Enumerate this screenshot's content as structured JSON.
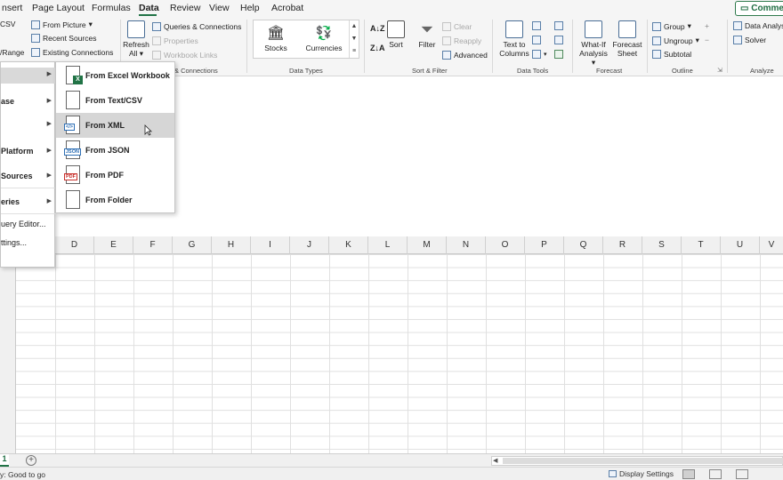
{
  "tabs": [
    "nsert",
    "Page Layout",
    "Formulas",
    "Data",
    "Review",
    "View",
    "Help",
    "Acrobat"
  ],
  "active_tab": "Data",
  "comments_label": "Commen",
  "ribbon": {
    "get_data": {
      "csv": "CSV",
      "range": "/Range"
    },
    "from_picture": "From Picture",
    "recent_sources": "Recent Sources",
    "existing_connections": "Existing Connections",
    "refresh_all": {
      "line1": "Refresh",
      "line2": "All"
    },
    "queries_connections": "Queries & Connections",
    "properties": "Properties",
    "workbook_links": "Workbook Links",
    "queries_group": "& Connections",
    "stocks": "Stocks",
    "currencies": "Currencies",
    "data_types_group": "Data Types",
    "sort": "Sort",
    "filter": "Filter",
    "clear": "Clear",
    "reapply": "Reapply",
    "advanced": "Advanced",
    "sort_filter_group": "Sort & Filter",
    "text_to_columns": {
      "line1": "Text to",
      "line2": "Columns"
    },
    "data_tools_group": "Data Tools",
    "what_if": {
      "line1": "What-If",
      "line2": "Analysis"
    },
    "forecast_sheet": {
      "line1": "Forecast",
      "line2": "Sheet"
    },
    "forecast_group": "Forecast",
    "group": "Group",
    "ungroup": "Ungroup",
    "subtotal": "Subtotal",
    "outline_group": "Outline",
    "data_analysis": "Data Analys",
    "solver": "Solver",
    "analyze_group": "Analyze"
  },
  "menu1": [
    {
      "label": "",
      "arrow": true
    },
    {
      "label": "ase",
      "arrow": true
    },
    {
      "label": "",
      "arrow": true
    },
    {
      "label": "Platform",
      "arrow": true
    },
    {
      "label": "Sources",
      "arrow": true
    },
    {
      "label": "eries",
      "arrow": true
    },
    {
      "label": "uery Editor...",
      "arrow": false
    },
    {
      "label": "ttings...",
      "arrow": false
    }
  ],
  "menu2": [
    {
      "label": "From Excel Workbook",
      "icon": "excel-workbook-icon"
    },
    {
      "label": "From Text/CSV",
      "icon": "text-csv-icon"
    },
    {
      "label": "From XML",
      "icon": "xml-icon"
    },
    {
      "label": "From JSON",
      "icon": "json-icon"
    },
    {
      "label": "From PDF",
      "icon": "pdf-icon"
    },
    {
      "label": "From Folder",
      "icon": "folder-icon"
    }
  ],
  "columns": [
    "D",
    "E",
    "F",
    "G",
    "H",
    "I",
    "J",
    "K",
    "L",
    "M",
    "N",
    "O",
    "P",
    "Q",
    "R",
    "S",
    "T",
    "U",
    "V"
  ],
  "sheet_tab": "1",
  "status": "y: Good to go",
  "display_settings": "Display Settings",
  "colors": {
    "accent": "#217346",
    "menu_hover": "#d6d6d6"
  }
}
